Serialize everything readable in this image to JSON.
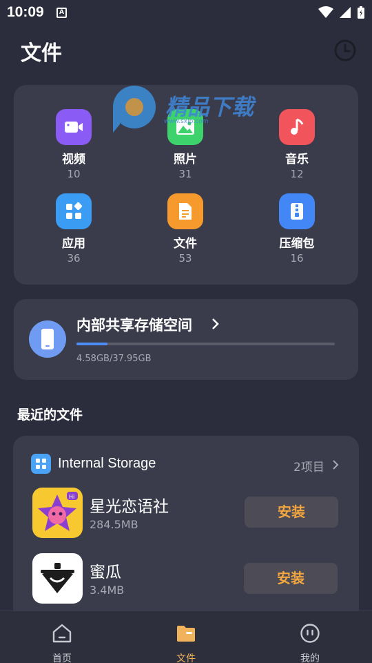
{
  "status_bar": {
    "time": "10:09",
    "notification_letter": "A"
  },
  "header": {
    "title": "文件"
  },
  "categories": [
    {
      "label": "视频",
      "count": "10",
      "icon": "video-icon",
      "color": "#8a5cf5"
    },
    {
      "label": "照片",
      "count": "31",
      "icon": "photo-icon",
      "color": "#3ed26c"
    },
    {
      "label": "音乐",
      "count": "12",
      "icon": "music-icon",
      "color": "#f2545b"
    },
    {
      "label": "应用",
      "count": "36",
      "icon": "apps-icon",
      "color": "#3b9cf4"
    },
    {
      "label": "文件",
      "count": "53",
      "icon": "document-icon",
      "color": "#f79a2e"
    },
    {
      "label": "压缩包",
      "count": "16",
      "icon": "archive-icon",
      "color": "#4287f5"
    }
  ],
  "storage": {
    "title": "内部共享存储空间",
    "used_text": "4.58GB/37.95GB",
    "used_fraction": 0.12
  },
  "recent": {
    "section_title": "最近的文件",
    "group_title": "Internal Storage",
    "group_count": "2项目",
    "files": [
      {
        "name": "星光恋语社",
        "size": "284.5MB",
        "button": "安装"
      },
      {
        "name": "蜜瓜",
        "size": "3.4MB",
        "button": "安装"
      }
    ]
  },
  "bottom_nav": [
    {
      "label": "首页",
      "icon": "home-icon",
      "active": false
    },
    {
      "label": "文件",
      "icon": "folder-icon",
      "active": true
    },
    {
      "label": "我的",
      "icon": "profile-icon",
      "active": false
    }
  ],
  "colors": {
    "background": "#2b2d3c",
    "card": "#3a3c4c",
    "accent": "#f0b25a",
    "progress": "#4d8ef6"
  }
}
